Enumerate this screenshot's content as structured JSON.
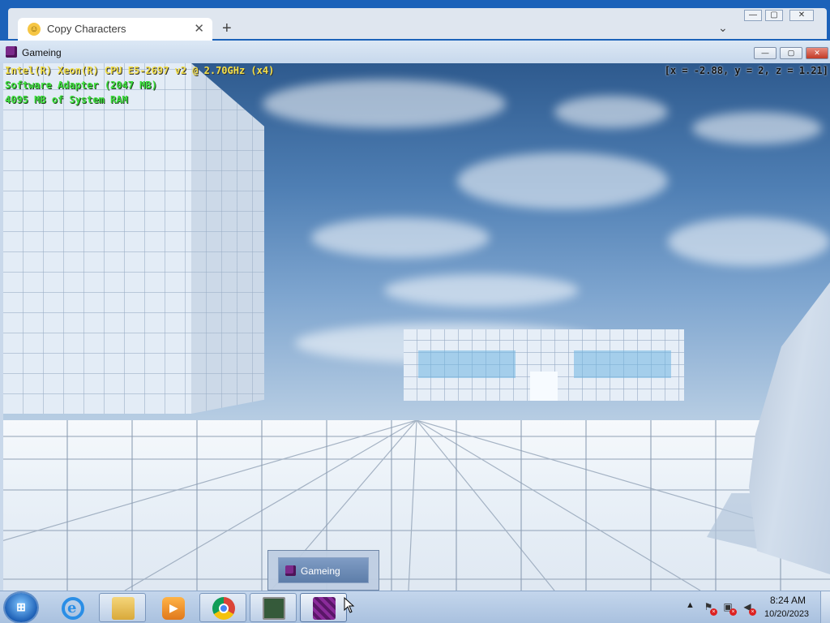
{
  "browser": {
    "tab_title": "Copy Characters",
    "tab_close": "✕",
    "new_tab": "+",
    "tab_search": "⌄",
    "window_controls": {
      "minimize": "—",
      "maximize": "▢",
      "close": "✕"
    }
  },
  "game_window": {
    "title": "Gameing",
    "controls": {
      "minimize": "—",
      "maximize": "▢",
      "close": "✕"
    },
    "hud": {
      "cpu": "Intel(R) Xeon(R) CPU E5-2697 v2 @ 2.70GHz (x4)",
      "gpu": "Software Adapter (2047 MB)",
      "ram": "4095 MB of System RAM",
      "coords": "[x = -2.88, y = 2, z = 1.21]"
    }
  },
  "taskbar_preview": {
    "label": "Gameing"
  },
  "taskbar": {
    "start_glyph": "⊞",
    "pinned": [
      "internet-explorer",
      "file-explorer",
      "media-player",
      "chrome",
      "system-monitor",
      "gameing"
    ],
    "tray_up": "▲",
    "clock_time": "8:24 AM",
    "clock_date": "10/20/2023"
  },
  "colors": {
    "hud_yellow": "#f3e04a",
    "hud_green": "#3ee03e",
    "taskbar": "#b7cbe6",
    "sky_top": "#2e5a8e"
  }
}
